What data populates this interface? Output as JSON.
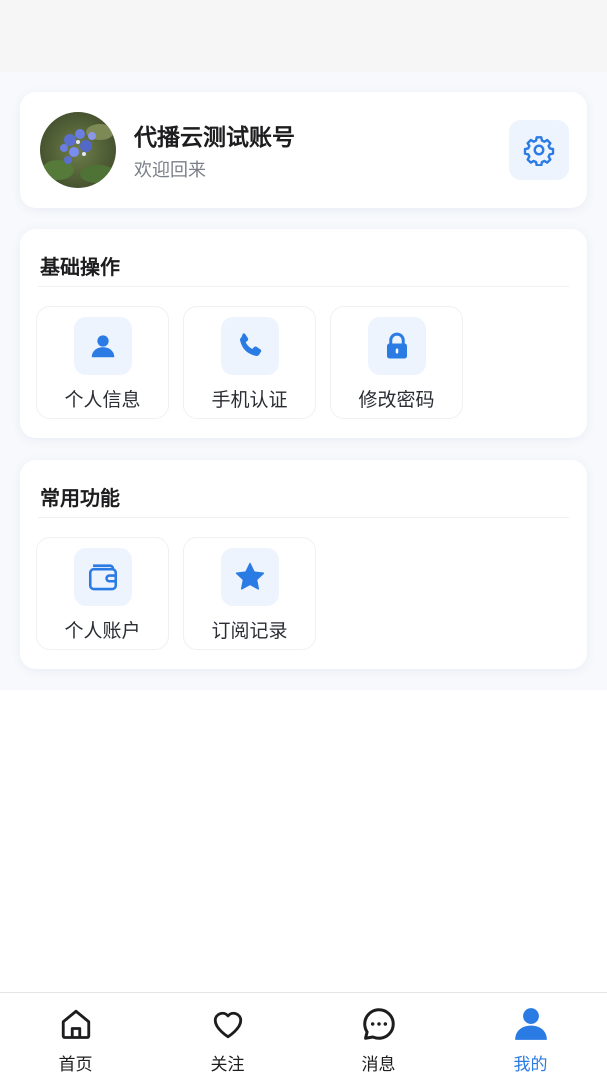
{
  "colors": {
    "accent": "#2b7be4",
    "icon_bg": "#edf4fd",
    "page_bg": "#f7f9fc",
    "text_primary": "#1d1d1f",
    "text_secondary": "#7a7f88"
  },
  "profile": {
    "name": "代播云测试账号",
    "subtitle": "欢迎回来",
    "avatar_icon": "flower-photo-avatar",
    "settings_icon": "gear-icon"
  },
  "sections": [
    {
      "title": "基础操作",
      "items": [
        {
          "label": "个人信息",
          "icon": "person-icon"
        },
        {
          "label": "手机认证",
          "icon": "phone-icon"
        },
        {
          "label": "修改密码",
          "icon": "lock-icon"
        }
      ]
    },
    {
      "title": "常用功能",
      "items": [
        {
          "label": "个人账户",
          "icon": "wallet-icon"
        },
        {
          "label": "订阅记录",
          "icon": "star-icon"
        }
      ]
    }
  ],
  "tabbar": {
    "items": [
      {
        "label": "首页",
        "icon": "home-icon",
        "active": false
      },
      {
        "label": "关注",
        "icon": "heart-icon",
        "active": false
      },
      {
        "label": "消息",
        "icon": "chat-bubble-icon",
        "active": false
      },
      {
        "label": "我的",
        "icon": "person-icon",
        "active": true
      }
    ]
  }
}
